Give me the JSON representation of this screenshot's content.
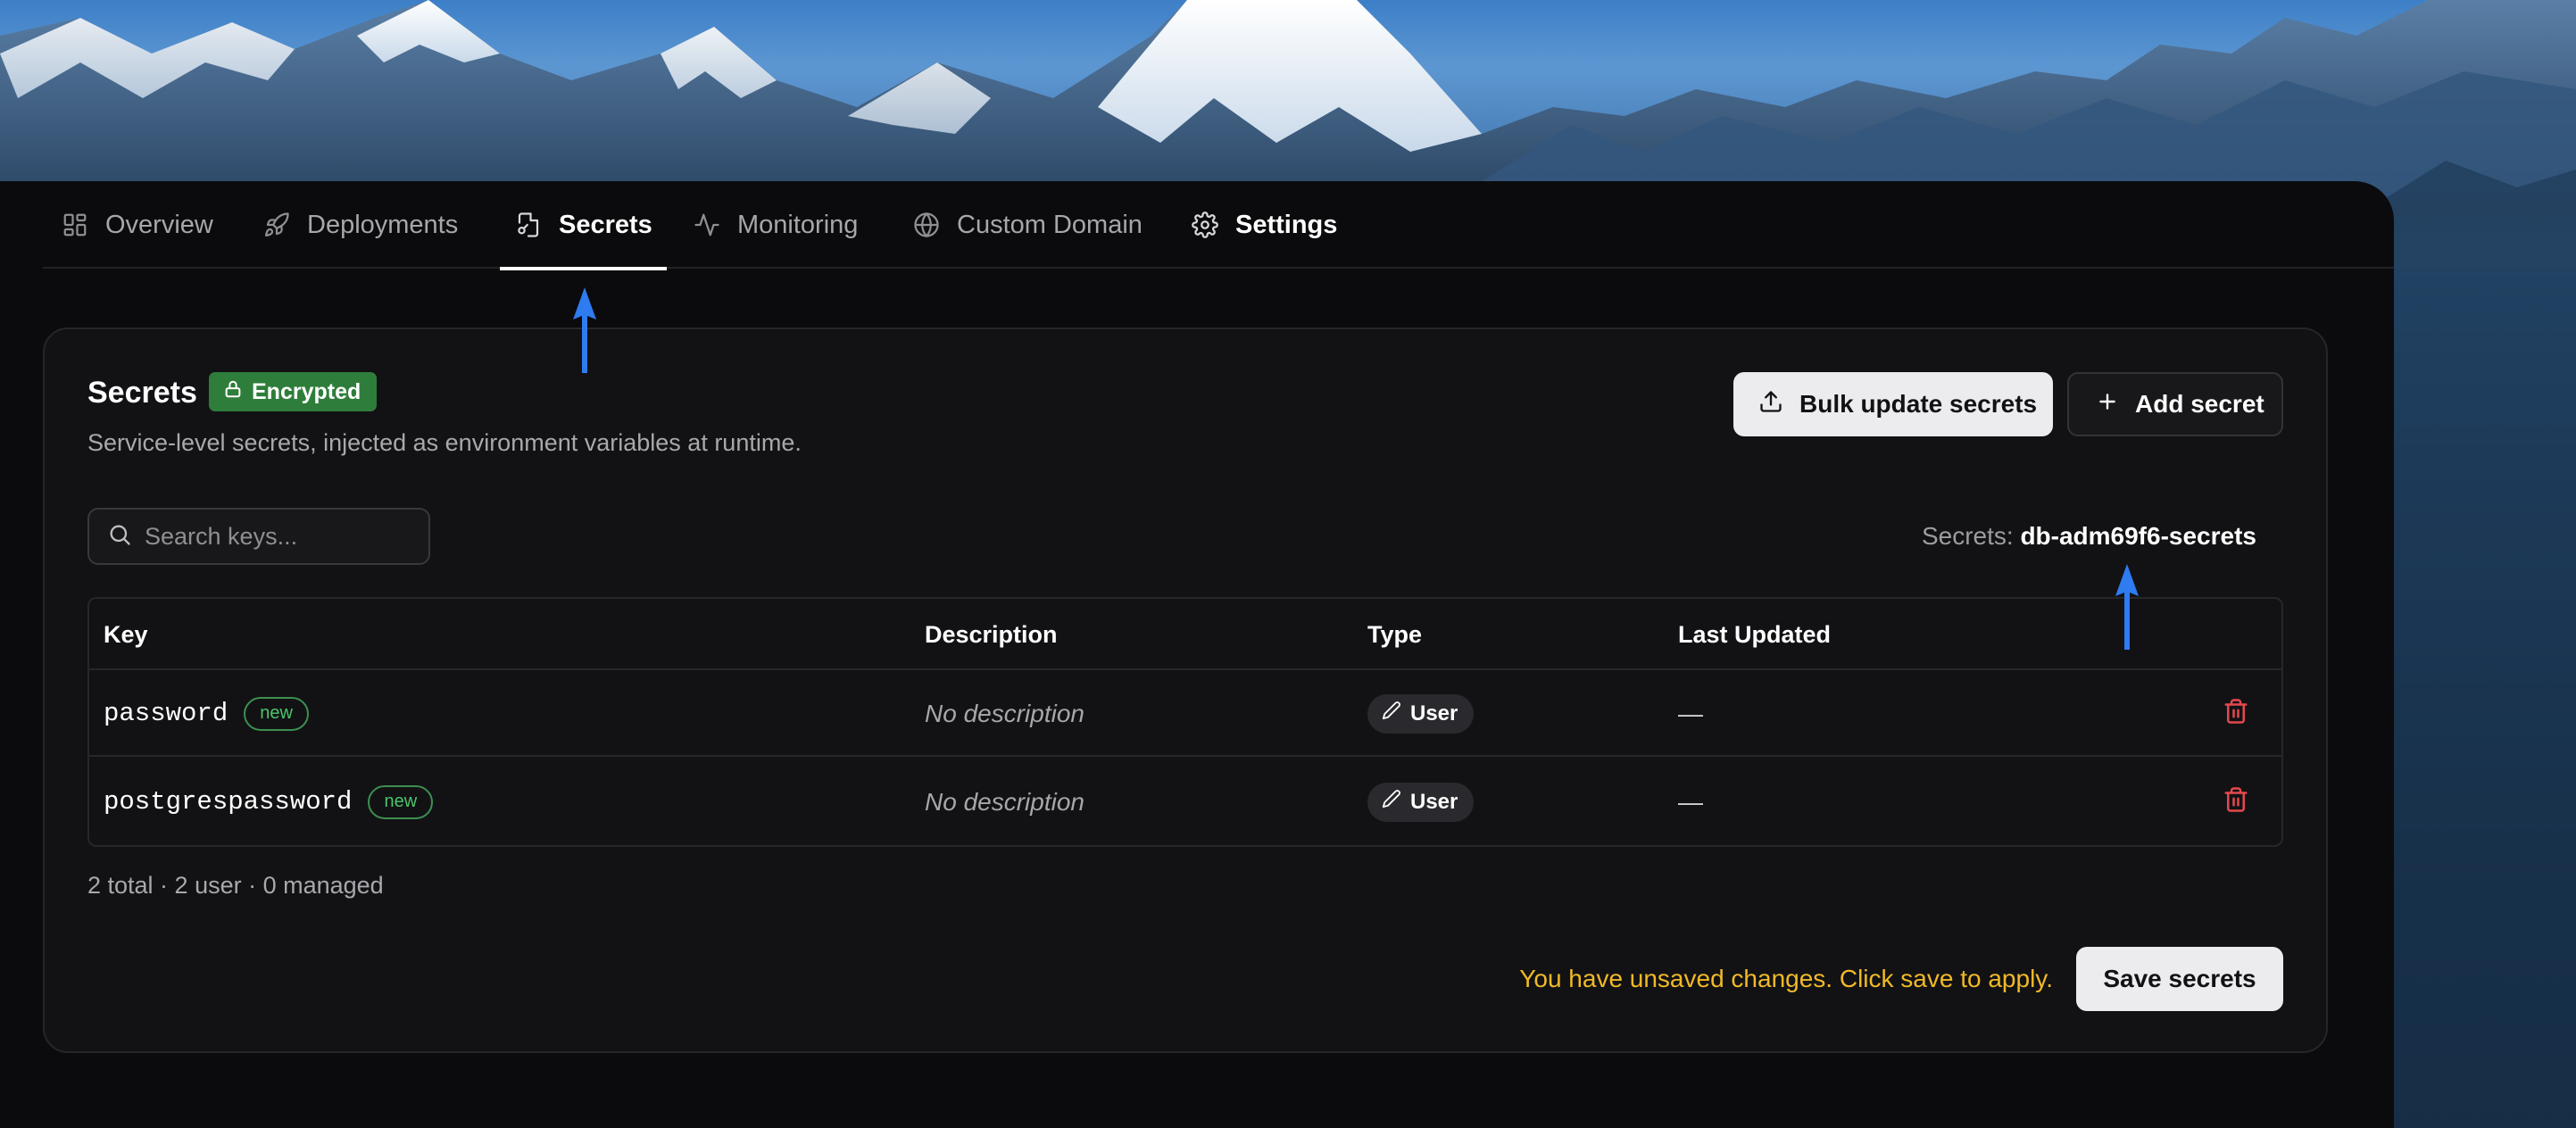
{
  "tabs": [
    {
      "label": "Overview",
      "icon": "grid-icon"
    },
    {
      "label": "Deployments",
      "icon": "rocket-icon"
    },
    {
      "label": "Secrets",
      "icon": "file-key-icon",
      "active": true
    },
    {
      "label": "Monitoring",
      "icon": "activity-icon"
    },
    {
      "label": "Custom Domain",
      "icon": "globe-icon"
    },
    {
      "label": "Settings",
      "icon": "gear-icon"
    }
  ],
  "card": {
    "title": "Secrets",
    "badge": "Encrypted",
    "subtitle": "Service-level secrets, injected as environment variables at runtime.",
    "bulk_update_label": "Bulk update secrets",
    "add_secret_label": "Add secret"
  },
  "search": {
    "placeholder": "Search keys..."
  },
  "secret_store": {
    "label": "Secrets:",
    "name": "db-adm69f6-secrets"
  },
  "table": {
    "headers": [
      "Key",
      "Description",
      "Type",
      "Last Updated"
    ],
    "rows": [
      {
        "key": "password",
        "badge": "new",
        "description": "No description",
        "type": "User",
        "last_updated": "—"
      },
      {
        "key": "postgrespassword",
        "badge": "new",
        "description": "No description",
        "type": "User",
        "last_updated": "—"
      }
    ]
  },
  "summary": "2 total · 2 user · 0 managed",
  "footer": {
    "unsaved_message": "You have unsaved changes. Click save to apply.",
    "save_label": "Save secrets"
  },
  "colors": {
    "accent_green": "#2f7d3b",
    "new_green": "#4cc46a",
    "warning_yellow": "#f1b927",
    "danger_red": "#e5484d",
    "arrow_blue": "#2f7bf0"
  }
}
